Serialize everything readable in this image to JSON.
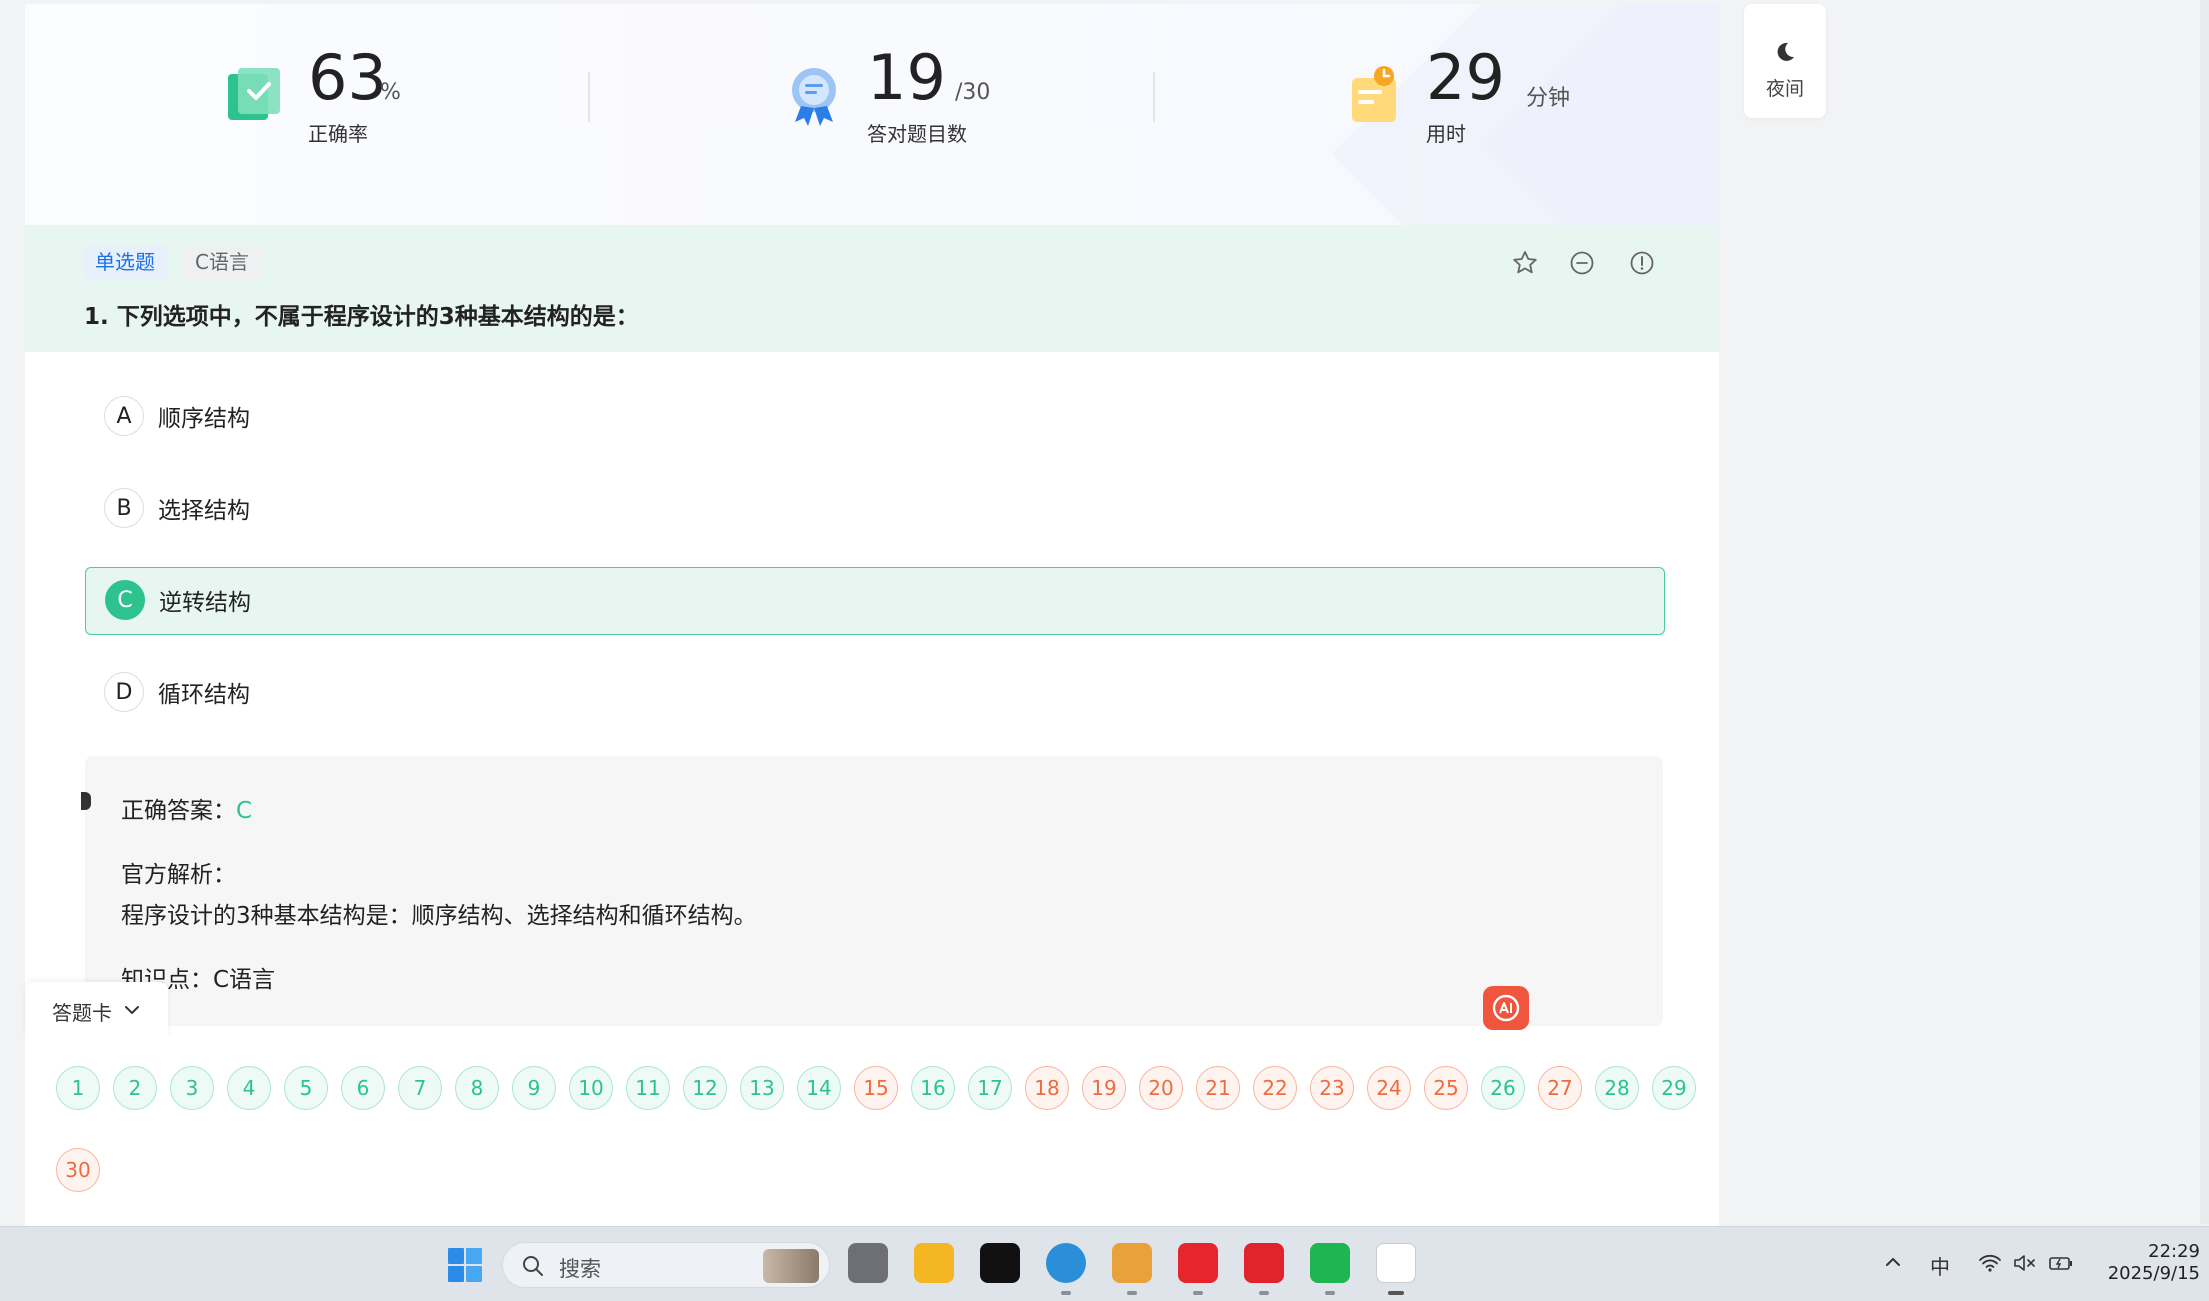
{
  "stats": [
    {
      "value": "63",
      "unit": "%",
      "label": "正确率"
    },
    {
      "value": "19",
      "unit": "/30",
      "label": "答对题目数"
    },
    {
      "value": "29",
      "unit": "分钟",
      "label": "用时"
    }
  ],
  "question": {
    "type_tag": "单选题",
    "category_tag": "C语言",
    "title": "1. 下列选项中，不属于程序设计的3种基本结构的是："
  },
  "options": [
    {
      "letter": "A",
      "text": "顺序结构",
      "selected": false
    },
    {
      "letter": "B",
      "text": "选择结构",
      "selected": false
    },
    {
      "letter": "C",
      "text": "逆转结构",
      "selected": true
    },
    {
      "letter": "D",
      "text": "循环结构",
      "selected": false
    }
  ],
  "analysis": {
    "answer_label": "正确答案：",
    "answer_value": "C",
    "official_label": "官方解析：",
    "official_text": "程序设计的3种基本结构是：顺序结构、选择结构和循环结构。",
    "knowledge": "知识点：C语言"
  },
  "answer_card": {
    "label": "答题卡",
    "items": [
      {
        "n": "1",
        "status": "correct"
      },
      {
        "n": "2",
        "status": "correct"
      },
      {
        "n": "3",
        "status": "correct"
      },
      {
        "n": "4",
        "status": "correct"
      },
      {
        "n": "5",
        "status": "correct"
      },
      {
        "n": "6",
        "status": "correct"
      },
      {
        "n": "7",
        "status": "correct"
      },
      {
        "n": "8",
        "status": "correct"
      },
      {
        "n": "9",
        "status": "correct"
      },
      {
        "n": "10",
        "status": "correct"
      },
      {
        "n": "11",
        "status": "correct"
      },
      {
        "n": "12",
        "status": "correct"
      },
      {
        "n": "13",
        "status": "correct"
      },
      {
        "n": "14",
        "status": "correct"
      },
      {
        "n": "15",
        "status": "wrong"
      },
      {
        "n": "16",
        "status": "correct"
      },
      {
        "n": "17",
        "status": "correct"
      },
      {
        "n": "18",
        "status": "wrong"
      },
      {
        "n": "19",
        "status": "wrong"
      },
      {
        "n": "20",
        "status": "wrong"
      },
      {
        "n": "21",
        "status": "wrong"
      },
      {
        "n": "22",
        "status": "wrong"
      },
      {
        "n": "23",
        "status": "wrong"
      },
      {
        "n": "24",
        "status": "wrong"
      },
      {
        "n": "25",
        "status": "wrong"
      },
      {
        "n": "26",
        "status": "correct"
      },
      {
        "n": "27",
        "status": "wrong"
      },
      {
        "n": "28",
        "status": "correct"
      },
      {
        "n": "29",
        "status": "correct"
      },
      {
        "n": "30",
        "status": "wrong"
      }
    ]
  },
  "night_mode": {
    "label": "夜间",
    "icon": "moon-icon"
  },
  "colors": {
    "accent": "#2ec28f",
    "wrong": "#f06a3d",
    "link": "#1a73e8",
    "header_bg": "#e8f6f2"
  },
  "taskbar": {
    "search_placeholder": "搜索",
    "tray_ime": "中",
    "time": "22:29",
    "date": "2025/9/15"
  }
}
